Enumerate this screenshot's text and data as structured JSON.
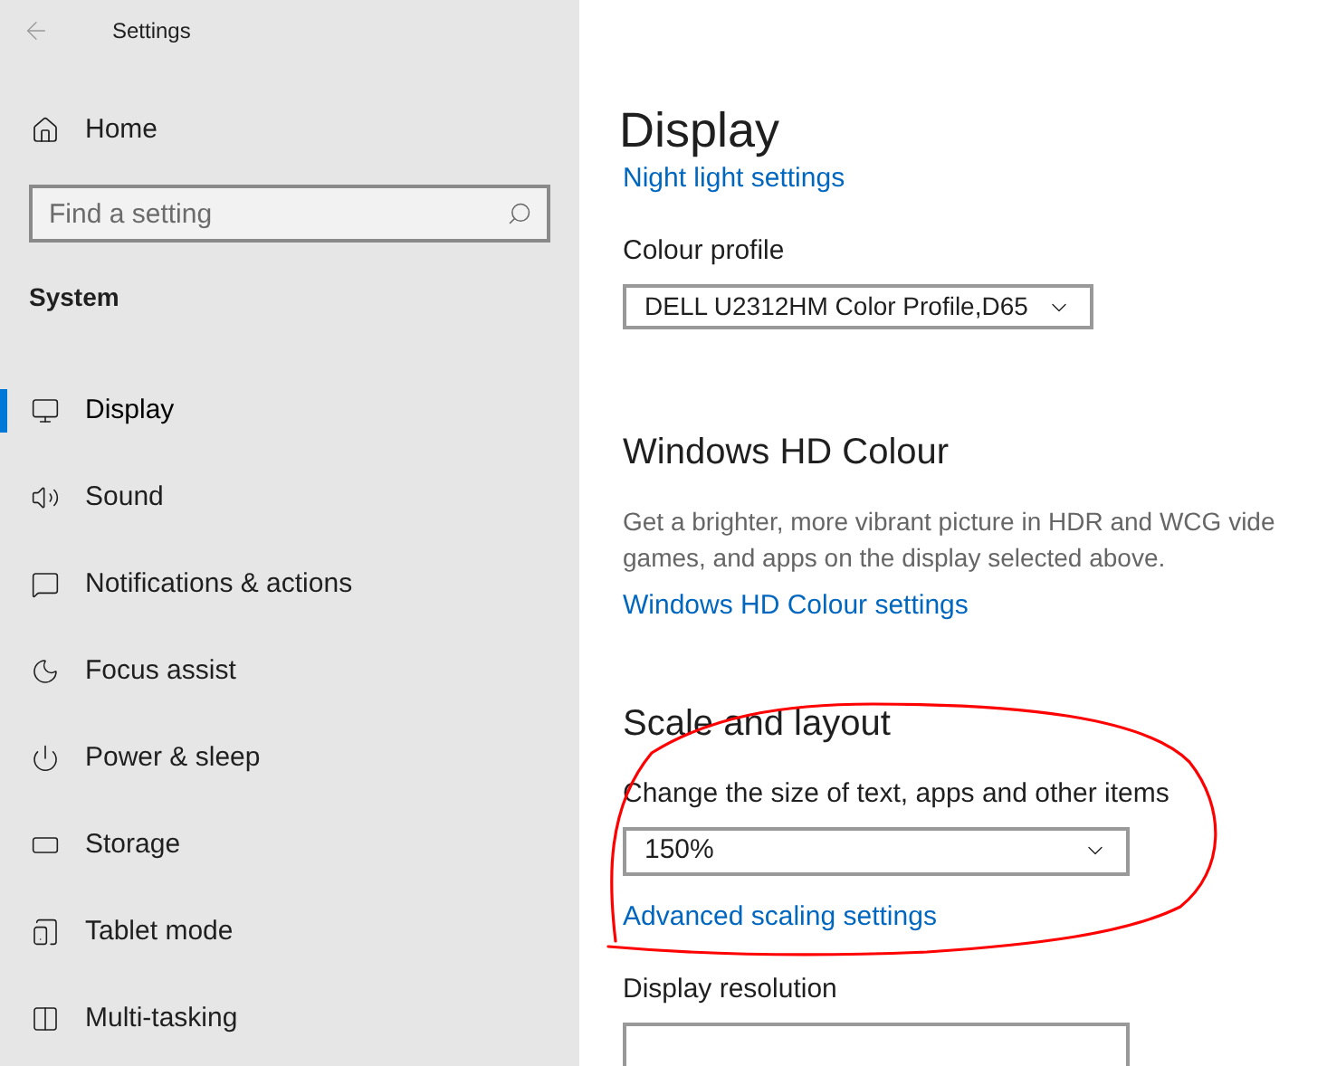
{
  "window": {
    "title": "Settings"
  },
  "sidebar": {
    "home": "Home",
    "search": {
      "placeholder": "Find a setting"
    },
    "section": "System",
    "items": [
      {
        "label": "Display",
        "selected": true
      },
      {
        "label": "Sound",
        "selected": false
      },
      {
        "label": "Notifications & actions",
        "selected": false
      },
      {
        "label": "Focus assist",
        "selected": false
      },
      {
        "label": "Power & sleep",
        "selected": false
      },
      {
        "label": "Storage",
        "selected": false
      },
      {
        "label": "Tablet mode",
        "selected": false
      },
      {
        "label": "Multi-tasking",
        "selected": false
      }
    ]
  },
  "main": {
    "title": "Display",
    "night_light_link": "Night light settings",
    "colour_profile": {
      "label": "Colour profile",
      "value": "DELL U2312HM Color Profile,D65"
    },
    "hd_colour": {
      "heading": "Windows HD Colour",
      "description_lines": [
        "Get a brighter, more vibrant picture in HDR and WCG vide",
        "games, and apps on the display selected above."
      ],
      "link": "Windows HD Colour settings"
    },
    "scale": {
      "heading": "Scale and layout",
      "label": "Change the size of text, apps and other items",
      "value": "150%",
      "link": "Advanced scaling settings",
      "resolution_label": "Display resolution"
    }
  }
}
